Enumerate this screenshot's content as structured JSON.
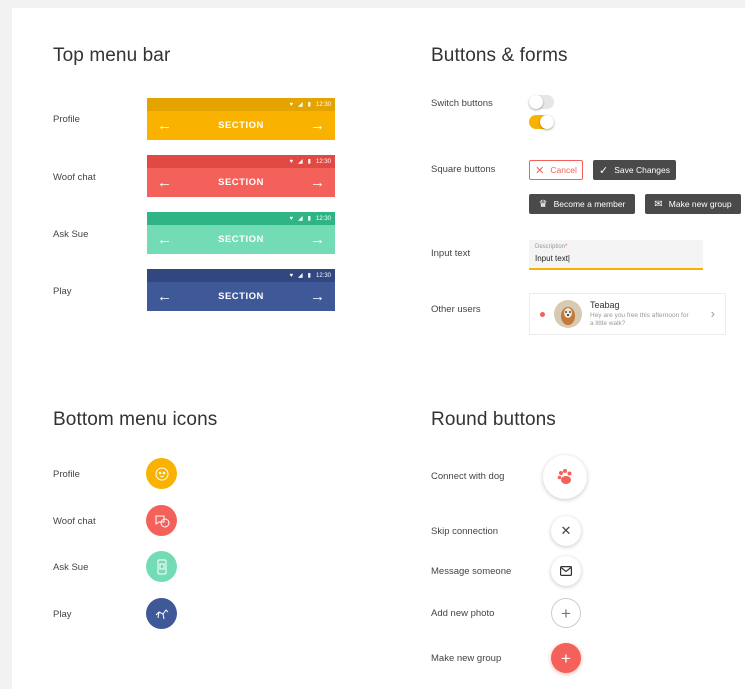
{
  "sections": {
    "top_menu": "Top menu bar",
    "buttons_forms": "Buttons & forms",
    "bottom_icons": "Bottom menu icons",
    "round_buttons": "Round buttons"
  },
  "top_bars": [
    {
      "label": "Profile",
      "title": "SECTION",
      "time": "12:30",
      "color": "#f9b200",
      "status_color": "#e5a300"
    },
    {
      "label": "Woof chat",
      "title": "SECTION",
      "time": "12:30",
      "color": "#f4615a",
      "status_color": "#e04a43"
    },
    {
      "label": "Ask Sue",
      "title": "SECTION",
      "time": "12:30",
      "color": "#74dcb5",
      "status_color": "#2fb585"
    },
    {
      "label": "Play",
      "title": "SECTION",
      "time": "12:30",
      "color": "#3f5897",
      "status_color": "#324780"
    }
  ],
  "forms": {
    "switch_label": "Switch buttons",
    "switch_on_color": "#f9b200",
    "square_label": "Square buttons",
    "cancel": "Cancel",
    "save": "Save Changes",
    "member": "Become a member",
    "group": "Make new group",
    "input_label": "Input text",
    "input_placeholder": "Description",
    "input_value": "Input text|",
    "users_label": "Other users",
    "user_name": "Teabag",
    "user_message": "Hey are you free this afternoon for a little walk?"
  },
  "bottom_icons": [
    {
      "label": "Profile",
      "icon": "dog-face-icon",
      "color": "#f9b200"
    },
    {
      "label": "Woof chat",
      "icon": "chat-bubbles-icon",
      "color": "#f4615a"
    },
    {
      "label": "Ask Sue",
      "icon": "phone-icon",
      "color": "#74dcb5"
    },
    {
      "label": "Play",
      "icon": "dog-play-icon",
      "color": "#3f5897"
    }
  ],
  "round": [
    {
      "label": "Connect with dog",
      "icon": "paw-icon"
    },
    {
      "label": "Skip connection",
      "icon": "close-icon"
    },
    {
      "label": "Message someone",
      "icon": "envelope-icon"
    },
    {
      "label": "Add new photo",
      "icon": "plus-icon"
    },
    {
      "label": "Make new group",
      "icon": "plus-icon",
      "color": "#f4615a"
    }
  ]
}
